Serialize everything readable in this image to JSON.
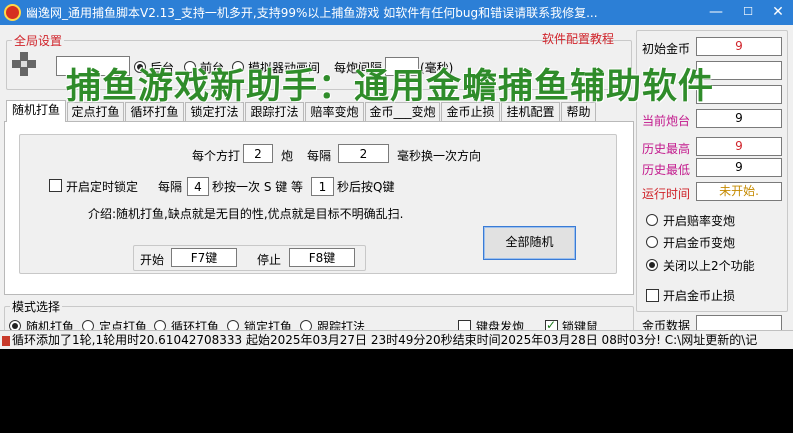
{
  "window": {
    "title": "幽逸网_通用捕鱼脚本V2.13_支持一机多开,支持99%以上捕鱼游戏  如软件有任何bug和错误请联系我修复..."
  },
  "overlay_text": "捕鱼游戏新助手：通用金蟾捕鱼辅助软件",
  "global_settings": {
    "title": "全局设置",
    "radio_1": "后台",
    "radio_2": "前台",
    "radio_3": "模拟器动画间",
    "interval_label": "每炮间隔",
    "interval_unit": "(毫秒)",
    "link": "软件配置教程"
  },
  "tabs": [
    {
      "label": "随机打鱼"
    },
    {
      "label": "定点打鱼"
    },
    {
      "label": "循环打鱼"
    },
    {
      "label": "锁定打法"
    },
    {
      "label": "跟踪打法"
    },
    {
      "label": "赔率变炮"
    },
    {
      "label": "金币___变炮"
    },
    {
      "label": "金币止损"
    },
    {
      "label": "挂机配置"
    },
    {
      "label": "帮助"
    }
  ],
  "random_tab": {
    "shots_prefix": "每个方打",
    "shots_value": "2",
    "shots_unit": "炮",
    "every_label": "每隔",
    "every_value": "2",
    "every_suffix": "毫秒换一次方向",
    "timer_lock_label": "开启定时锁定",
    "every2_label": "每隔",
    "every2_value": "4",
    "press_label": "秒按一次 S 键 等",
    "wait_value": "1",
    "after_label": "秒后按Q键",
    "description": "介绍:随机打鱼,缺点就是无目的性,优点就是目标不明确乱扫.",
    "start_label": "开始",
    "start_key": "F7键",
    "stop_label": "停止",
    "stop_key": "F8键",
    "all_random_button": "全部随机"
  },
  "mode_select": {
    "title": "模式选择",
    "options": [
      "随机打鱼",
      "定点打鱼",
      "循环打鱼",
      "锁定打鱼",
      "跟踪打法"
    ],
    "keyboard_cannon": "键盘发炮",
    "lock_key": "锁键鼠"
  },
  "stats": {
    "initial_gold_label": "初始金币",
    "initial_gold": "9",
    "current_cannon_label": "当前炮台",
    "current_cannon": "9",
    "history_high_label": "历史最高",
    "history_high": "9",
    "history_low_label": "历史最低",
    "history_low": "9",
    "runtime_label": "运行时间",
    "runtime": "未开始."
  },
  "right_options": {
    "odds_label": "开启赔率变炮",
    "gold_label": "开启金币变炮",
    "close_label": "关闭以上2个功能",
    "stoploss_label": "开启金币止损",
    "gold_data_label": "金币数据"
  },
  "statusbar": {
    "text": "循环添加了1轮,1轮用时20.61042708333   起始2025年03月27日 23时49分20秒结束时间2025年03月28日 08时03分! C:\\网址更新的\\记"
  },
  "colors": {
    "titlebar": "#2c7fd6",
    "accent_red": "#d0232a",
    "accent_magenta": "#c2188c",
    "overlay_green": "#2f8c2a"
  }
}
